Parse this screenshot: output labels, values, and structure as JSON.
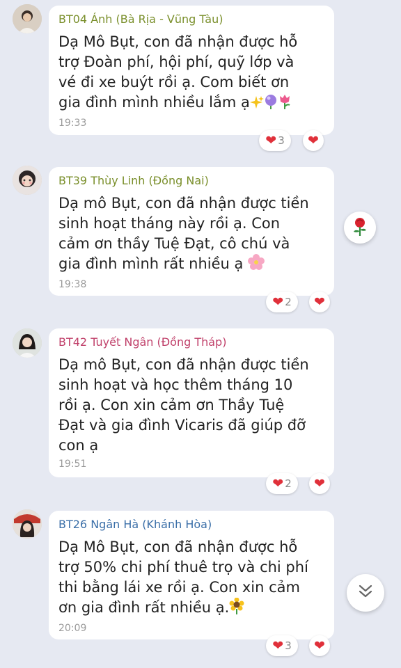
{
  "colors": {
    "background": "#e6e9f2",
    "bubble": "#ffffff",
    "heart": "#e0303a",
    "sender_1": "#7a8f2b",
    "sender_2": "#7a8f2b",
    "sender_3": "#c0406a",
    "sender_4": "#3b6fa8"
  },
  "messages": [
    {
      "sender": "BT04 Ánh (Bà Rịa - Vũng Tàu)",
      "text": "Dạ Mô Bụt, con đã nhận được hỗ\ntrợ Đoàn phí, hội phí, quỹ lớp và\nvé đi xe buýt rồi ạ. Com biết ơn\ngia đình mình nhiều lắm ạ",
      "emojis": [
        "sparkles-icon",
        "bubble-icon",
        "tulip-icon"
      ],
      "time": "19:33",
      "reaction_count": "3"
    },
    {
      "sender": "BT39 Thùy Linh (Đồng Nai)",
      "text": "Dạ mô Bụt, con đã nhận được tiền\nsinh hoạt tháng này rồi ạ. Con\ncảm ơn thầy Tuệ Đạt, cô chú và\ngia đình mình rất nhiều ạ",
      "emojis": [
        "cherry-blossom-icon"
      ],
      "time": "19:38",
      "reaction_count": "2"
    },
    {
      "sender": "BT42 Tuyết Ngân (Đồng Tháp)",
      "text": "Dạ mô Bụt, con đã nhận được tiền\nsinh hoạt và học thêm tháng 10\nrồi ạ. Con xin cảm ơn Thầy Tuệ\nĐạt và gia đình Vicaris đã giúp đỡ\ncon ạ",
      "emojis": [],
      "time": "19:51",
      "reaction_count": "2"
    },
    {
      "sender": "BT26 Ngân Hà (Khánh Hòa)",
      "text": "Dạ Mô Bụt, con đã nhận được hỗ\ntrợ 50% chi phí thuê trọ và chi phí\nthi bằng lái xe rồi ạ. Con xin cảm\nơn gia đình rất nhiều ạ.",
      "emojis": [
        "sunflower-icon"
      ],
      "time": "20:09",
      "reaction_count": "3"
    }
  ],
  "floating": {
    "rose_button": "rose-icon",
    "scroll_down_button": "double-chevron-down-icon"
  }
}
